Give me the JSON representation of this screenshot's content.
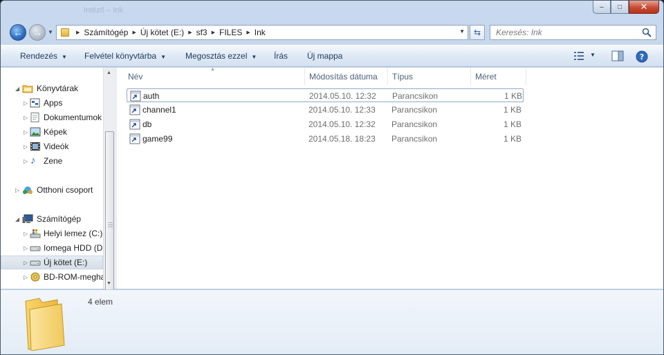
{
  "titlebar": {
    "title": "Intéző – Ink",
    "buttons": {
      "minimize": "–",
      "maximize": "□",
      "close": "✕"
    }
  },
  "address": {
    "breadcrumbs": [
      "Számítógép",
      "Új kötet (E:)",
      "sf3",
      "FILES",
      "Ink"
    ],
    "search_placeholder": "Keresés: Ink"
  },
  "toolbar": {
    "organize": "Rendezés",
    "include_in_library": "Felvétel könyvtárba",
    "share_with": "Megosztás ezzel",
    "burn": "Írás",
    "new_folder": "Új mappa"
  },
  "navigation": {
    "items": [
      {
        "label": "Könyvtárak",
        "icon": "library-icon",
        "level": 0,
        "expanded": true
      },
      {
        "label": "Apps",
        "icon": "apps-library-icon",
        "level": 1
      },
      {
        "label": "Dokumentumok",
        "icon": "documents-icon",
        "level": 1
      },
      {
        "label": "Képek",
        "icon": "pictures-icon",
        "level": 1
      },
      {
        "label": "Videók",
        "icon": "videos-icon",
        "level": 1
      },
      {
        "label": "Zene",
        "icon": "music-icon",
        "level": 1
      },
      {
        "label": "Otthoni csoport",
        "icon": "homegroup-icon",
        "level": 0
      },
      {
        "label": "Számítógép",
        "icon": "computer-icon",
        "level": 0,
        "expanded": true
      },
      {
        "label": "Helyi lemez (C:)",
        "icon": "system-drive-icon",
        "level": 1
      },
      {
        "label": "Iomega HDD (D:)",
        "icon": "drive-icon",
        "level": 1
      },
      {
        "label": "Új kötet (E:)",
        "icon": "drive-icon",
        "level": 1,
        "selected": true
      },
      {
        "label": "BD-ROM-meghajtó",
        "icon": "disc-drive-icon",
        "level": 1
      }
    ]
  },
  "files": {
    "columns": {
      "name": "Név",
      "modified": "Módosítás dátuma",
      "type": "Típus",
      "size": "Méret"
    },
    "rows": [
      {
        "name": "auth",
        "modified": "2014.05.10. 12:32",
        "type": "Parancsikon",
        "size": "1 KB"
      },
      {
        "name": "channel1",
        "modified": "2014.05.10. 12:33",
        "type": "Parancsikon",
        "size": "1 KB"
      },
      {
        "name": "db",
        "modified": "2014.05.10. 12:32",
        "type": "Parancsikon",
        "size": "1 KB"
      },
      {
        "name": "game99",
        "modified": "2014.05.18. 18:23",
        "type": "Parancsikon",
        "size": "1 KB"
      }
    ]
  },
  "details": {
    "count": "4 elem"
  },
  "colors": {
    "accent": "#2b5ea8",
    "toolbar_text": "#1e395b",
    "column_header": "#4c607a",
    "folder": "#e2b33d"
  }
}
